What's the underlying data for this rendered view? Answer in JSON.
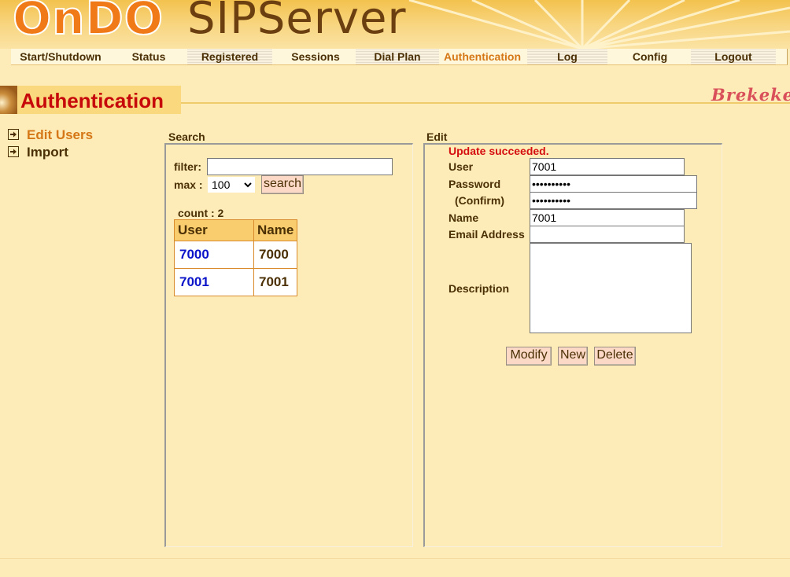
{
  "header": {
    "logo_ondo": "OnDO",
    "logo_product": "SIPServer",
    "brand": "Brekeke"
  },
  "nav": {
    "items": [
      {
        "label": "Start/Shutdown",
        "active": false
      },
      {
        "label": "Status",
        "active": false
      },
      {
        "label": "Registered",
        "active": false
      },
      {
        "label": "Sessions",
        "active": false
      },
      {
        "label": "Dial Plan",
        "active": false
      },
      {
        "label": "Authentication",
        "active": true
      },
      {
        "label": "Log",
        "active": false
      },
      {
        "label": "Config",
        "active": false
      },
      {
        "label": "Logout",
        "active": false
      }
    ]
  },
  "page": {
    "title": "Authentication"
  },
  "sidebar": {
    "items": [
      {
        "label": "Edit Users",
        "active": true
      },
      {
        "label": "Import",
        "active": false
      }
    ]
  },
  "search_panel": {
    "title": "Search",
    "filter_label": "filter:",
    "filter_value": "",
    "max_label": "max :",
    "max_value": "100",
    "max_options": [
      "100"
    ],
    "search_button": "search",
    "count_text": "count : 2",
    "table": {
      "headers": [
        "User",
        "Name"
      ],
      "rows": [
        {
          "user": "7000",
          "name": "7000"
        },
        {
          "user": "7001",
          "name": "7001"
        }
      ]
    }
  },
  "edit_panel": {
    "title": "Edit",
    "status": "Update succeeded.",
    "user_label": "User",
    "user_value": "7001",
    "password_label": "Password",
    "password_value": "••••••••••",
    "confirm_label": "(Confirm)",
    "confirm_value": "••••••••••",
    "name_label": "Name",
    "name_value": "7001",
    "email_label": "Email Address",
    "email_value": "",
    "description_label": "Description",
    "description_value": "",
    "buttons": {
      "modify": "Modify",
      "new": "New",
      "delete": "Delete"
    }
  },
  "colors": {
    "background": "#fdebb8",
    "accent_orange": "#d57716",
    "title_red": "#c7080a",
    "status_red": "#d50f0f",
    "link_blue": "#0b14c8",
    "text_brown": "#4b3005"
  }
}
